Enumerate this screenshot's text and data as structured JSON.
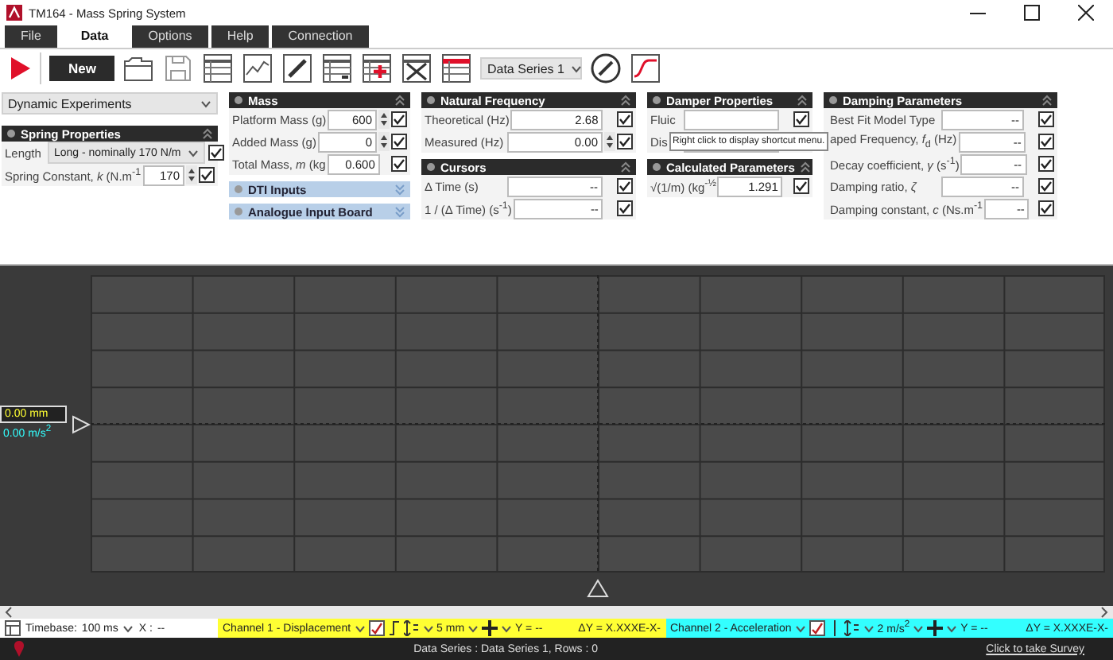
{
  "window": {
    "title": "TM164 - Mass Spring System"
  },
  "tabs": [
    {
      "label": "File",
      "selected": false
    },
    {
      "label": "Data",
      "selected": true
    },
    {
      "label": "Options",
      "selected": false
    },
    {
      "label": "Help",
      "selected": false
    },
    {
      "label": "Connection",
      "selected": false
    }
  ],
  "toolbar": {
    "new_button": "New",
    "series_select": "Data Series 1"
  },
  "columns": [
    {
      "select": "Dynamic Experiments",
      "panels": [
        {
          "title": "Spring Properties",
          "kind": "dark",
          "expanded": true,
          "rows": [
            {
              "kind": "select",
              "label": "Length",
              "value": "Long - nominally 170 N/m",
              "checked": true
            },
            {
              "kind": "field",
              "label": "Spring Constant, *k* (N.m$^{-1}$",
              "value": "170",
              "spinner": true,
              "checked": true
            }
          ]
        }
      ]
    },
    {
      "panels": [
        {
          "title": "Mass",
          "kind": "dark",
          "expanded": true,
          "rows": [
            {
              "kind": "field",
              "label": "Platform Mass (g)",
              "value": "600",
              "spinner": true,
              "checked": true
            },
            {
              "kind": "field",
              "label": "Added Mass (g)",
              "value": "0",
              "spinner": true,
              "checked": true
            },
            {
              "kind": "field",
              "label": "Total Mass, *m* (kg",
              "value": "0.600",
              "spinner": false,
              "checked": true
            }
          ]
        },
        {
          "title": "DTI Inputs",
          "kind": "light",
          "expanded": false
        },
        {
          "title": "Analogue Input Board",
          "kind": "light",
          "expanded": false
        }
      ]
    },
    {
      "panels": [
        {
          "title": "Natural Frequency",
          "kind": "dark",
          "expanded": true,
          "rows": [
            {
              "kind": "field",
              "label": "Theoretical (Hz)",
              "value": "2.68",
              "spinner": false,
              "checked": true
            },
            {
              "kind": "field",
              "label": "Measured (Hz)",
              "value": "0.00",
              "spinner": true,
              "checked": true
            }
          ]
        },
        {
          "title": "Cursors",
          "kind": "dark",
          "expanded": true,
          "rows": [
            {
              "kind": "field",
              "label": "Δ Time (s)",
              "value": "--",
              "spinner": false,
              "checked": true
            },
            {
              "kind": "field",
              "label": "1 / (Δ Time) (s$^{-1}$)",
              "value": "--",
              "spinner": false,
              "checked": true
            }
          ]
        }
      ]
    },
    {
      "panels": [
        {
          "title": "Damper Properties",
          "kind": "dark",
          "expanded": true,
          "rows": [
            {
              "kind": "field",
              "label": "Fluic",
              "spinner": false,
              "checked": true
            },
            {
              "kind": "field",
              "label": "Dis",
              "spinner": false
            }
          ]
        },
        {
          "title": "Calculated Parameters",
          "kind": "dark",
          "expanded": true,
          "rows": [
            {
              "kind": "field",
              "label": "√(1/m) (kg$^{-½}$",
              "value": "1.291",
              "spinner": false,
              "checked": true
            }
          ]
        }
      ]
    },
    {
      "panels": [
        {
          "title": "Damping Parameters",
          "kind": "dark",
          "expanded": true,
          "rows": [
            {
              "kind": "field",
              "label": "Best Fit Model Type",
              "value": "--",
              "spinner": false,
              "checked": true
            },
            {
              "kind": "field",
              "label": "aped Frequency, *f*$_{d}$ (Hz)",
              "value": "--",
              "spinner": false,
              "checked": true
            },
            {
              "kind": "field",
              "label": "Decay coefficient, *γ* (s$^{-1}$)",
              "value": "--",
              "spinner": false,
              "checked": true
            },
            {
              "kind": "field",
              "label": "Damping ratio, *ζ*",
              "value": "--",
              "spinner": false,
              "checked": true
            },
            {
              "kind": "field",
              "label": "Damping constant, *c* (Ns.m$^{-1}$",
              "value": "--",
              "spinner": false,
              "checked": true
            }
          ]
        }
      ]
    }
  ],
  "tooltip": "Right click to display shortcut menu.",
  "timebase": {
    "label": "Timebase:",
    "value": "100 ms",
    "x_label": "X :",
    "x_value": "--"
  },
  "channels": [
    {
      "name": "Channel 1 - Displacement",
      "scale": "5 mm",
      "y": "Y = --",
      "dy": "ΔY = X.XXXE-X-",
      "color": "#ffff33",
      "reading": "0.00 mm"
    },
    {
      "name": "Channel 2 - Acceleration",
      "scale": "2 m/s$^{2}$",
      "y": "Y = --",
      "dy": "ΔY = X.XXXE-X-",
      "color": "#33ffff",
      "reading": "0.00 m/s$^{2}$"
    }
  ],
  "status_bar": {
    "text": "Data Series : Data Series 1,  Rows : 0",
    "link": "Click to take Survey"
  }
}
